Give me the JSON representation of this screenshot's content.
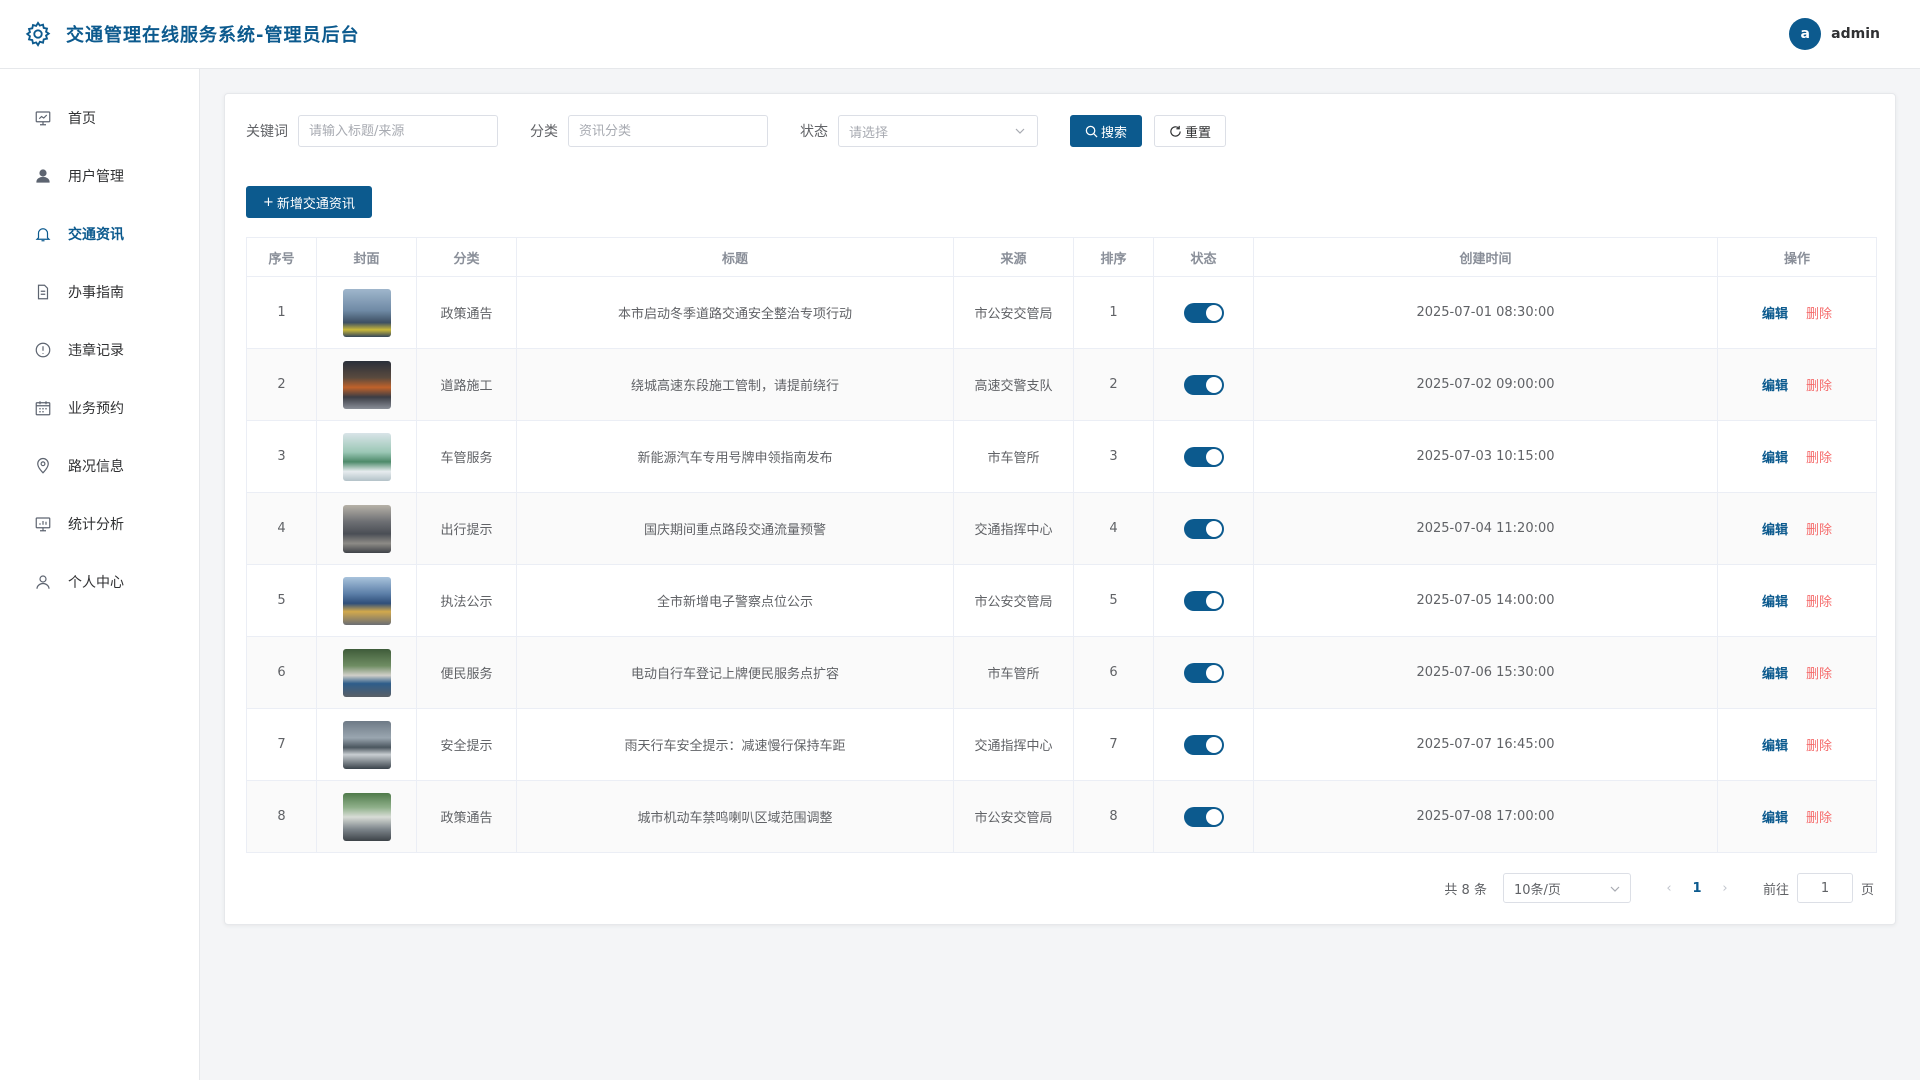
{
  "app": {
    "title": "交通管理在线服务系统-管理员后台"
  },
  "user": {
    "initial": "a",
    "name": "admin"
  },
  "sidebar": {
    "items": [
      {
        "label": "首页",
        "icon": "monitor-icon",
        "active": false
      },
      {
        "label": "用户管理",
        "icon": "user-solid-icon",
        "active": false
      },
      {
        "label": "交通资讯",
        "icon": "bell-icon",
        "active": true
      },
      {
        "label": "办事指南",
        "icon": "document-icon",
        "active": false
      },
      {
        "label": "违章记录",
        "icon": "warning-circle-icon",
        "active": false
      },
      {
        "label": "业务预约",
        "icon": "calendar-icon",
        "active": false
      },
      {
        "label": "路况信息",
        "icon": "location-icon",
        "active": false
      },
      {
        "label": "统计分析",
        "icon": "chart-monitor-icon",
        "active": false
      },
      {
        "label": "个人中心",
        "icon": "user-outline-icon",
        "active": false
      }
    ]
  },
  "filters": {
    "keyword_label": "关键词",
    "keyword_placeholder": "请输入标题/来源",
    "category_label": "分类",
    "category_placeholder": "资讯分类",
    "status_label": "状态",
    "status_placeholder": "请选择",
    "search_label": "搜索",
    "reset_label": "重置"
  },
  "toolbar": {
    "add_label": "新增交通资讯"
  },
  "table": {
    "headers": [
      "序号",
      "封面",
      "分类",
      "标题",
      "来源",
      "排序",
      "状态",
      "创建时间",
      "操作"
    ],
    "edit_label": "编辑",
    "delete_label": "删除",
    "rows": [
      {
        "no": "1",
        "category": "政策通告",
        "title": "本市启动冬季道路交通安全整治专项行动",
        "source": "市公安交管局",
        "sort": "1",
        "enabled": true,
        "created": "2025-07-01 08:30:00"
      },
      {
        "no": "2",
        "category": "道路施工",
        "title": "绕城高速东段施工管制，请提前绕行",
        "source": "高速交警支队",
        "sort": "2",
        "enabled": true,
        "created": "2025-07-02 09:00:00"
      },
      {
        "no": "3",
        "category": "车管服务",
        "title": "新能源汽车专用号牌申领指南发布",
        "source": "市车管所",
        "sort": "3",
        "enabled": true,
        "created": "2025-07-03 10:15:00"
      },
      {
        "no": "4",
        "category": "出行提示",
        "title": "国庆期间重点路段交通流量预警",
        "source": "交通指挥中心",
        "sort": "4",
        "enabled": true,
        "created": "2025-07-04 11:20:00"
      },
      {
        "no": "5",
        "category": "执法公示",
        "title": "全市新增电子警察点位公示",
        "source": "市公安交管局",
        "sort": "5",
        "enabled": true,
        "created": "2025-07-05 14:00:00"
      },
      {
        "no": "6",
        "category": "便民服务",
        "title": "电动自行车登记上牌便民服务点扩容",
        "source": "市车管所",
        "sort": "6",
        "enabled": true,
        "created": "2025-07-06 15:30:00"
      },
      {
        "no": "7",
        "category": "安全提示",
        "title": "雨天行车安全提示：减速慢行保持车距",
        "source": "交通指挥中心",
        "sort": "7",
        "enabled": true,
        "created": "2025-07-07 16:45:00"
      },
      {
        "no": "8",
        "category": "政策通告",
        "title": "城市机动车禁鸣喇叭区域范围调整",
        "source": "市公安交管局",
        "sort": "8",
        "enabled": true,
        "created": "2025-07-08 17:00:00"
      }
    ]
  },
  "pagination": {
    "total_text": "共 8 条",
    "page_size": "10条/页",
    "current_page": "1",
    "goto_label": "前往",
    "goto_value": "1",
    "page_suffix": "页"
  },
  "colors": {
    "primary": "#0c5a8e",
    "danger": "#f56c6c"
  }
}
